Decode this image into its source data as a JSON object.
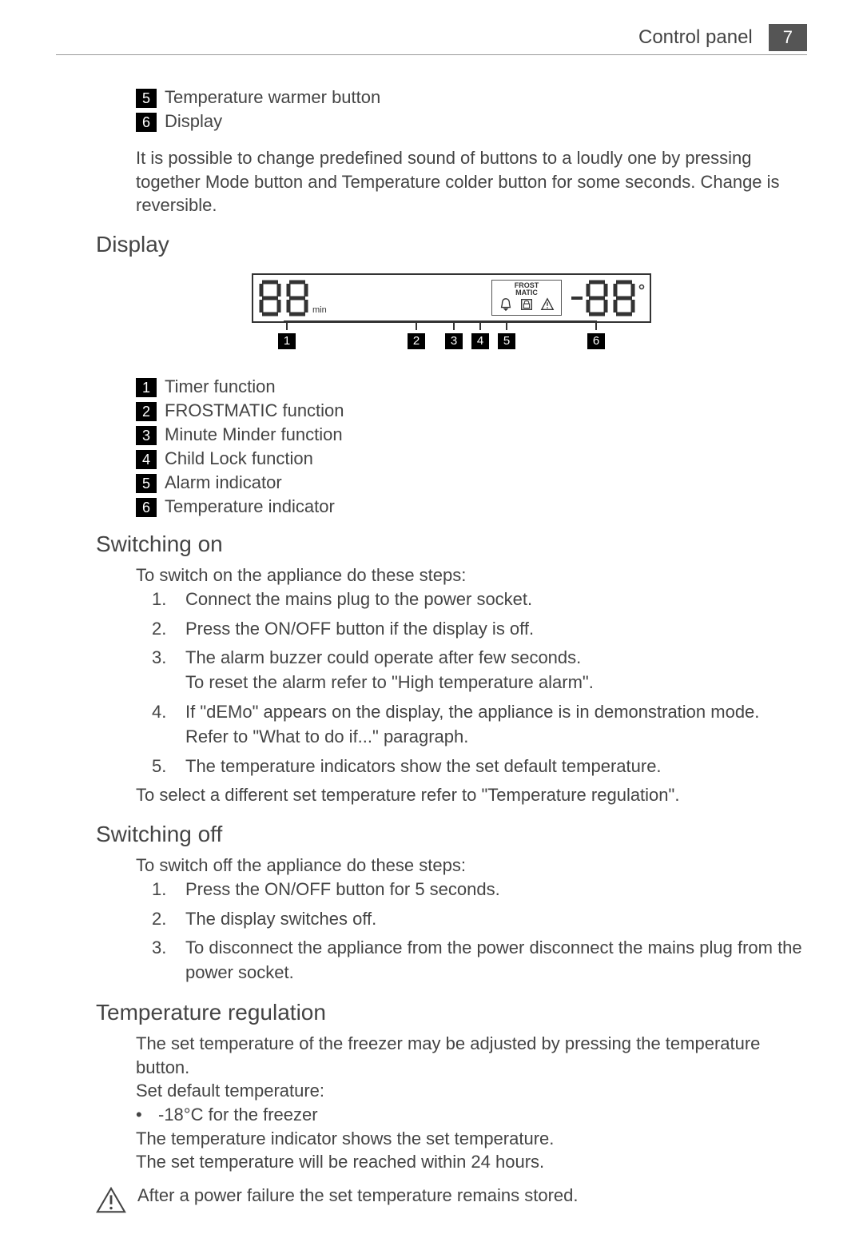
{
  "header": {
    "title": "Control panel",
    "page_number": "7"
  },
  "top_legend": [
    {
      "num": "5",
      "text": "Temperature warmer button"
    },
    {
      "num": "6",
      "text": "Display"
    }
  ],
  "top_paragraph": "It is possible to change predefined sound of buttons to a loudly one by pressing together Mode button and Temperature colder button for some seconds. Change is reversible.",
  "sections": {
    "display": {
      "heading": "Display",
      "frostmatic_label_line1": "FROST",
      "frostmatic_label_line2": "MATIC",
      "min_label": "min",
      "pointers": [
        "1",
        "2",
        "3",
        "4",
        "5",
        "6"
      ],
      "legend": [
        {
          "num": "1",
          "text": "Timer function"
        },
        {
          "num": "2",
          "text": "FROSTMATIC function"
        },
        {
          "num": "3",
          "text": "Minute Minder function"
        },
        {
          "num": "4",
          "text": "Child Lock function"
        },
        {
          "num": "5",
          "text": "Alarm indicator"
        },
        {
          "num": "6",
          "text": "Temperature indicator"
        }
      ]
    },
    "switching_on": {
      "heading": "Switching on",
      "intro": "To switch on the appliance do these steps:",
      "steps": [
        "Connect the mains plug to the power socket.",
        "Press the ON/OFF button if the display is off.",
        "The alarm buzzer could operate after few seconds.\nTo reset the alarm refer to \"High temperature alarm\".",
        "If \"dEMo\" appears on the display, the appliance is in demonstration mode. Refer to \"What to do if...\" paragraph.",
        "The temperature indicators show the set default temperature."
      ],
      "outro": "To select a different set temperature refer to \"Temperature regulation\"."
    },
    "switching_off": {
      "heading": "Switching off",
      "intro": "To switch off the appliance do these steps:",
      "steps": [
        "Press the ON/OFF button for 5 seconds.",
        "The display switches off.",
        "To disconnect the appliance from the power disconnect the mains plug from the power socket."
      ]
    },
    "temperature_regulation": {
      "heading": "Temperature regulation",
      "p1": "The set temperature of the freezer may be adjusted by pressing the temperature button.",
      "p2": "Set default temperature:",
      "bullet": "-18°C for the freezer",
      "p3": "The temperature indicator shows the set temperature.",
      "p4": "The set temperature will be reached within 24 hours.",
      "warning": "After a power failure the set temperature remains stored."
    }
  }
}
